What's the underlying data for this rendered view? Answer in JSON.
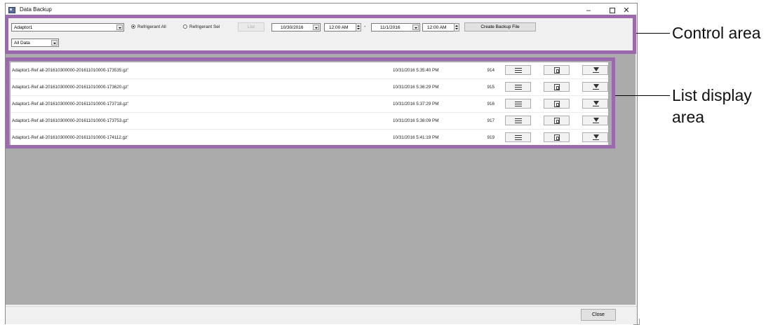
{
  "window": {
    "title": "Data Backup",
    "controls": {
      "minimize": "–",
      "maximize": "",
      "close": "✕"
    }
  },
  "controls": {
    "adaptor_select": {
      "value": "Adaptor1"
    },
    "radio_all": {
      "label": "Refrigerant All",
      "checked": true
    },
    "radio_sel": {
      "label": "Refrigerant Sel",
      "checked": false
    },
    "list_button": "List",
    "start_date": "10/30/2016",
    "start_time": "12:00 AM",
    "range_dash": "-",
    "end_date": "11/1/2016",
    "end_time": "12:00 AM",
    "create_button": "Create Backup File",
    "data_select": {
      "value": "All Data"
    }
  },
  "list": {
    "rows": [
      {
        "file": "Adaptor1-Ref all-201610300000-201611010000-173535.gz'",
        "date": "10/31/2016 5:35:40 PM",
        "num": "914"
      },
      {
        "file": "Adaptor1-Ref all-201610300000-201611010000-173620.gz'",
        "date": "10/31/2016 5:36:29 PM",
        "num": "915"
      },
      {
        "file": "Adaptor1-Ref all-201610300000-201611010000-173718.gz'",
        "date": "10/31/2016 5:37:29 PM",
        "num": "916"
      },
      {
        "file": "Adaptor1-Ref all-201610300000-201611010000-173753.gz'",
        "date": "10/31/2016 5:38:09 PM",
        "num": "917"
      },
      {
        "file": "Adaptor1-Ref all-201610300000-201611010000-174112.gz'",
        "date": "10/31/2016 5:41:19 PM",
        "num": "919"
      }
    ]
  },
  "footer": {
    "close_button": "Close"
  },
  "annotations": {
    "control_area": "Control area",
    "list_area_line1": "List display",
    "list_area_line2": "area"
  },
  "colors": {
    "highlight_frame": "#9b6aac",
    "list_background": "#ababab"
  }
}
